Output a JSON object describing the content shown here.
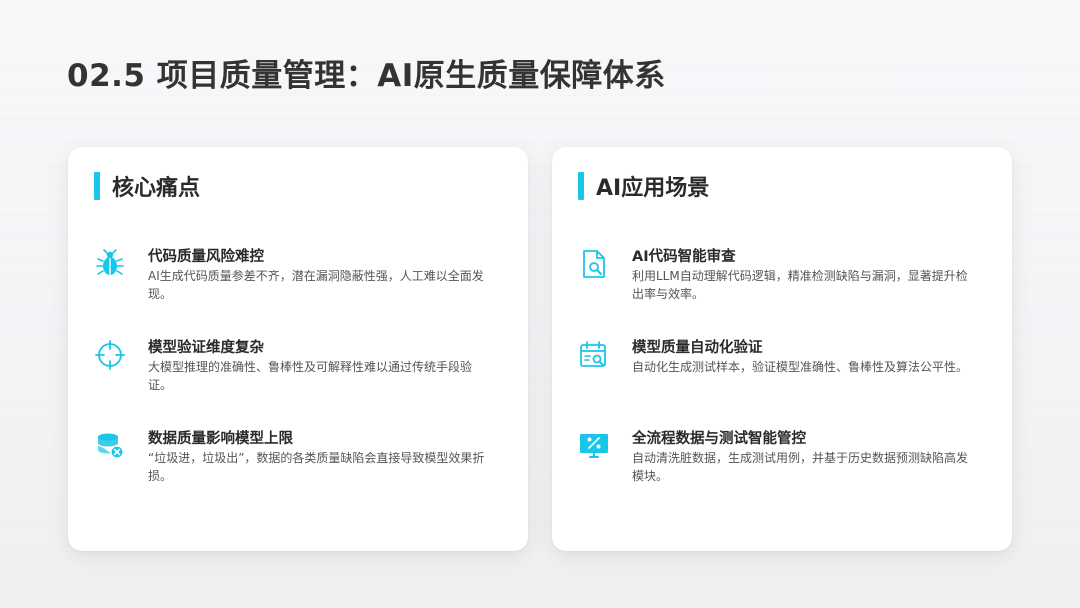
{
  "page": {
    "title": "02.5 项目质量管理：AI原生质量保障体系"
  },
  "left_card": {
    "title": "核心痛点",
    "items": [
      {
        "icon": "bug-icon",
        "title": "代码质量风险难控",
        "desc": "AI生成代码质量参差不齐，潜在漏洞隐蔽性强，人工难以全面发现。"
      },
      {
        "icon": "crosshair-icon",
        "title": "模型验证维度复杂",
        "desc": "大模型推理的准确性、鲁棒性及可解释性难以通过传统手段验证。"
      },
      {
        "icon": "database-error-icon",
        "title": "数据质量影响模型上限",
        "desc": "“垃圾进，垃圾出”，数据的各类质量缺陷会直接导致模型效果折损。"
      }
    ]
  },
  "right_card": {
    "title": "AI应用场景",
    "items": [
      {
        "icon": "file-search-icon",
        "title": "AI代码智能审查",
        "desc": "利用LLM自动理解代码逻辑，精准检测缺陷与漏洞，显著提升检出率与效率。"
      },
      {
        "icon": "calendar-search-icon",
        "title": "模型质量自动化验证",
        "desc": "自动化生成测试样本，验证模型准确性、鲁棒性及算法公平性。"
      },
      {
        "icon": "monitor-percent-icon",
        "title": "全流程数据与测试智能管控",
        "desc": "自动清洗脏数据，生成测试用例，并基于历史数据预测缺陷高发模块。"
      }
    ]
  },
  "colors": {
    "accent": "#17c6e8",
    "title_text": "#333333",
    "body_text": "#555555"
  }
}
